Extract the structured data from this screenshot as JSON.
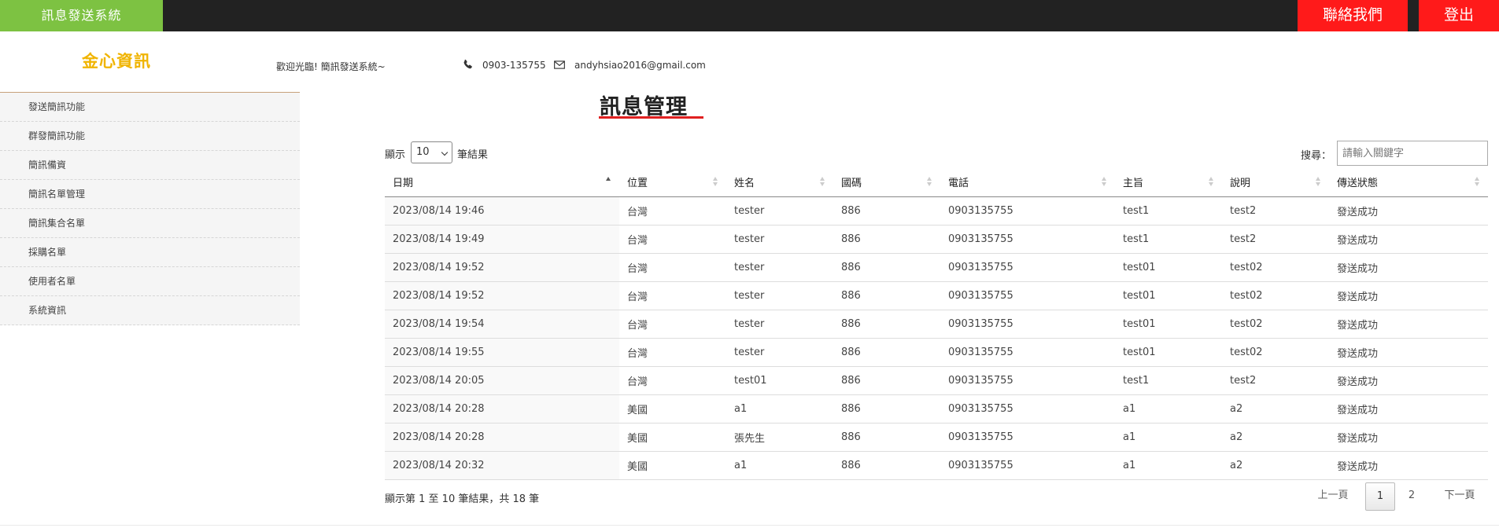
{
  "header": {
    "brand": "訊息發送系統",
    "contact_label": "聯絡我們",
    "logout_label": "登出",
    "colors": {
      "brand_bg": "#7dc242",
      "bar_bg": "#222222",
      "button_bg": "#ff1a1a"
    }
  },
  "logo": {
    "text": "金心資訊",
    "color": "#f0b400"
  },
  "info": {
    "welcome": "歡迎光臨! 簡訊發送系統~",
    "phone": "0903-135755",
    "email": "andyhsiao2016@gmail.com",
    "phone_icon": "phone-icon",
    "mail_icon": "mail-icon"
  },
  "sidebar": {
    "items": [
      {
        "label": "發送簡訊功能"
      },
      {
        "label": "群發簡訊功能"
      },
      {
        "label": "簡訊備資"
      },
      {
        "label": "簡訊名單管理"
      },
      {
        "label": "簡訊集合名單"
      },
      {
        "label": "採購名單"
      },
      {
        "label": "使用者名單"
      },
      {
        "label": "系統資訊"
      }
    ]
  },
  "main": {
    "title": "訊息管理",
    "length": {
      "prefix": "顯示",
      "selected": "10",
      "suffix": "筆結果"
    },
    "search": {
      "label": "搜尋：",
      "placeholder": "請輸入關鍵字",
      "value": ""
    },
    "columns": [
      "日期",
      "位置",
      "姓名",
      "國碼",
      "電話",
      "主旨",
      "說明",
      "傳送狀態"
    ],
    "sorted_column": "日期",
    "rows": [
      [
        "2023/08/14 19:46",
        "台灣",
        "tester",
        "886",
        "0903135755",
        "test1",
        "test2",
        "發送成功"
      ],
      [
        "2023/08/14 19:49",
        "台灣",
        "tester",
        "886",
        "0903135755",
        "test1",
        "test2",
        "發送成功"
      ],
      [
        "2023/08/14 19:52",
        "台灣",
        "tester",
        "886",
        "0903135755",
        "test01",
        "test02",
        "發送成功"
      ],
      [
        "2023/08/14 19:52",
        "台灣",
        "tester",
        "886",
        "0903135755",
        "test01",
        "test02",
        "發送成功"
      ],
      [
        "2023/08/14 19:54",
        "台灣",
        "tester",
        "886",
        "0903135755",
        "test01",
        "test02",
        "發送成功"
      ],
      [
        "2023/08/14 19:55",
        "台灣",
        "tester",
        "886",
        "0903135755",
        "test01",
        "test02",
        "發送成功"
      ],
      [
        "2023/08/14 20:05",
        "台灣",
        "test01",
        "886",
        "0903135755",
        "test1",
        "test2",
        "發送成功"
      ],
      [
        "2023/08/14 20:28",
        "美國",
        "a1",
        "886",
        "0903135755",
        "a1",
        "a2",
        "發送成功"
      ],
      [
        "2023/08/14 20:28",
        "美國",
        "張先生",
        "886",
        "0903135755",
        "a1",
        "a2",
        "發送成功"
      ],
      [
        "2023/08/14 20:32",
        "美國",
        "a1",
        "886",
        "0903135755",
        "a1",
        "a2",
        "發送成功"
      ]
    ],
    "info": "顯示第 1 至 10 筆結果，共 18 筆",
    "pagination": {
      "prev": "上一頁",
      "pages": [
        "1",
        "2"
      ],
      "current": "1",
      "next": "下一頁"
    }
  }
}
